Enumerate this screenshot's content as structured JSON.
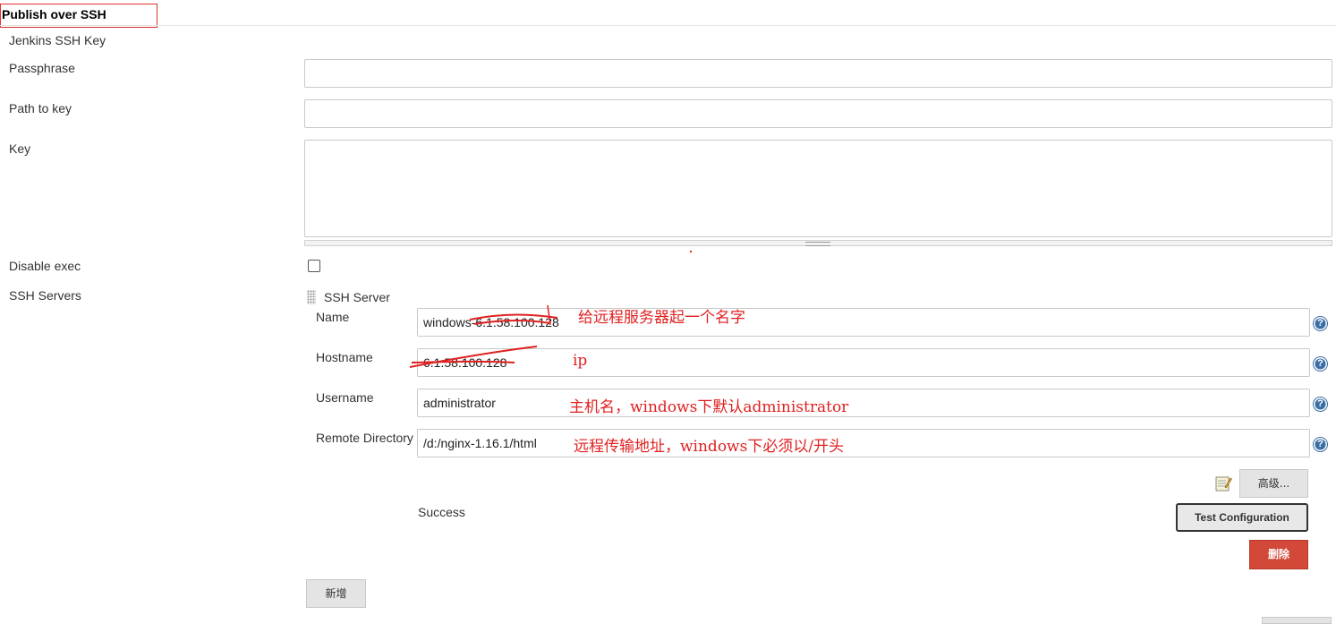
{
  "section": {
    "title": "Publish over SSH"
  },
  "jenkins_ssh_key": {
    "heading": "Jenkins SSH Key",
    "passphrase": {
      "label": "Passphrase",
      "value": ""
    },
    "path_to_key": {
      "label": "Path to key",
      "value": ""
    },
    "key": {
      "label": "Key",
      "value": ""
    },
    "disable_exec": {
      "label": "Disable exec",
      "checked": false
    }
  },
  "ssh_servers": {
    "label": "SSH Servers",
    "server": {
      "header": "SSH Server",
      "name": {
        "label": "Name",
        "value": "windows-6.1.58.100.128"
      },
      "hostname": {
        "label": "Hostname",
        "value": "6.1.58.100.128"
      },
      "username": {
        "label": "Username",
        "value": "administrator"
      },
      "remote_directory": {
        "label": "Remote Directory",
        "value": "/d:/nginx-1.16.1/html"
      },
      "help_icon_glyph": "?",
      "advanced_button": "高级...",
      "status_text": "Success",
      "test_button": "Test Configuration",
      "delete_button": "删除"
    },
    "add_button": "新增"
  },
  "annotations": {
    "name_note": "给远程服务器起一个名字",
    "hostname_note": "ip",
    "username_note": "主机名，windows下默认administrator",
    "remote_dir_note": "远程传输地址，windows下必须以/开头",
    "color": "#e02020"
  },
  "colors": {
    "delete_button_bg": "#d24939",
    "help_icon_bg": "#3b6ea5",
    "highlight_border": "#e03030"
  }
}
